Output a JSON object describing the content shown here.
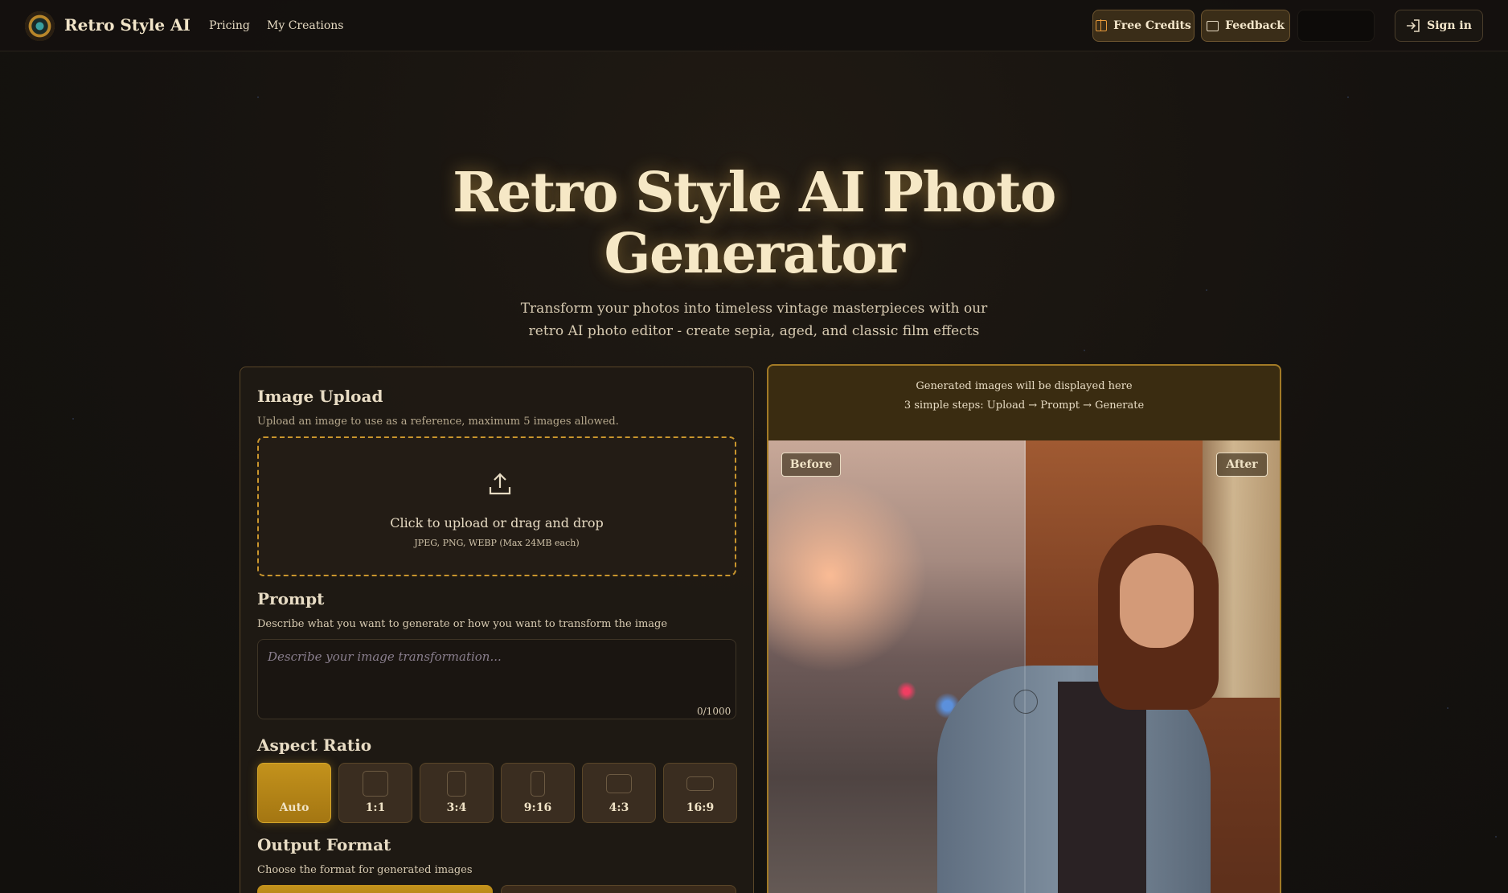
{
  "header": {
    "brand": "Retro Style AI",
    "nav": [
      "Pricing",
      "My Creations"
    ],
    "free_credits": "Free Credits",
    "feedback": "Feedback",
    "sign_in": "Sign in"
  },
  "hero": {
    "title_line1": "Retro Style AI Photo",
    "title_line2": "Generator",
    "subtitle_line1": "Transform your photos into timeless vintage masterpieces with our",
    "subtitle_line2": "retro AI photo editor - create sepia, aged, and classic film effects"
  },
  "upload": {
    "title": "Image Upload",
    "desc": "Upload an image to use as a reference, maximum 5 images allowed.",
    "cta": "Click to upload or drag and drop",
    "formats": "JPEG, PNG, WEBP (Max 24MB each)"
  },
  "prompt": {
    "title": "Prompt",
    "desc": "Describe what you want to generate or how you want to transform the image",
    "placeholder": "Describe your image transformation...",
    "counter": "0/1000"
  },
  "aspect": {
    "title": "Aspect Ratio",
    "options": [
      "Auto",
      "1:1",
      "3:4",
      "9:16",
      "4:3",
      "16:9"
    ],
    "selected": "Auto"
  },
  "output": {
    "title": "Output Format",
    "desc": "Choose the format for generated images"
  },
  "preview": {
    "line1": "Generated images will be displayed here",
    "line2": "3 simple steps: Upload → Prompt → Generate",
    "before": "Before",
    "after": "After"
  },
  "colors": {
    "accent": "#c9952d",
    "background": "#161310"
  }
}
